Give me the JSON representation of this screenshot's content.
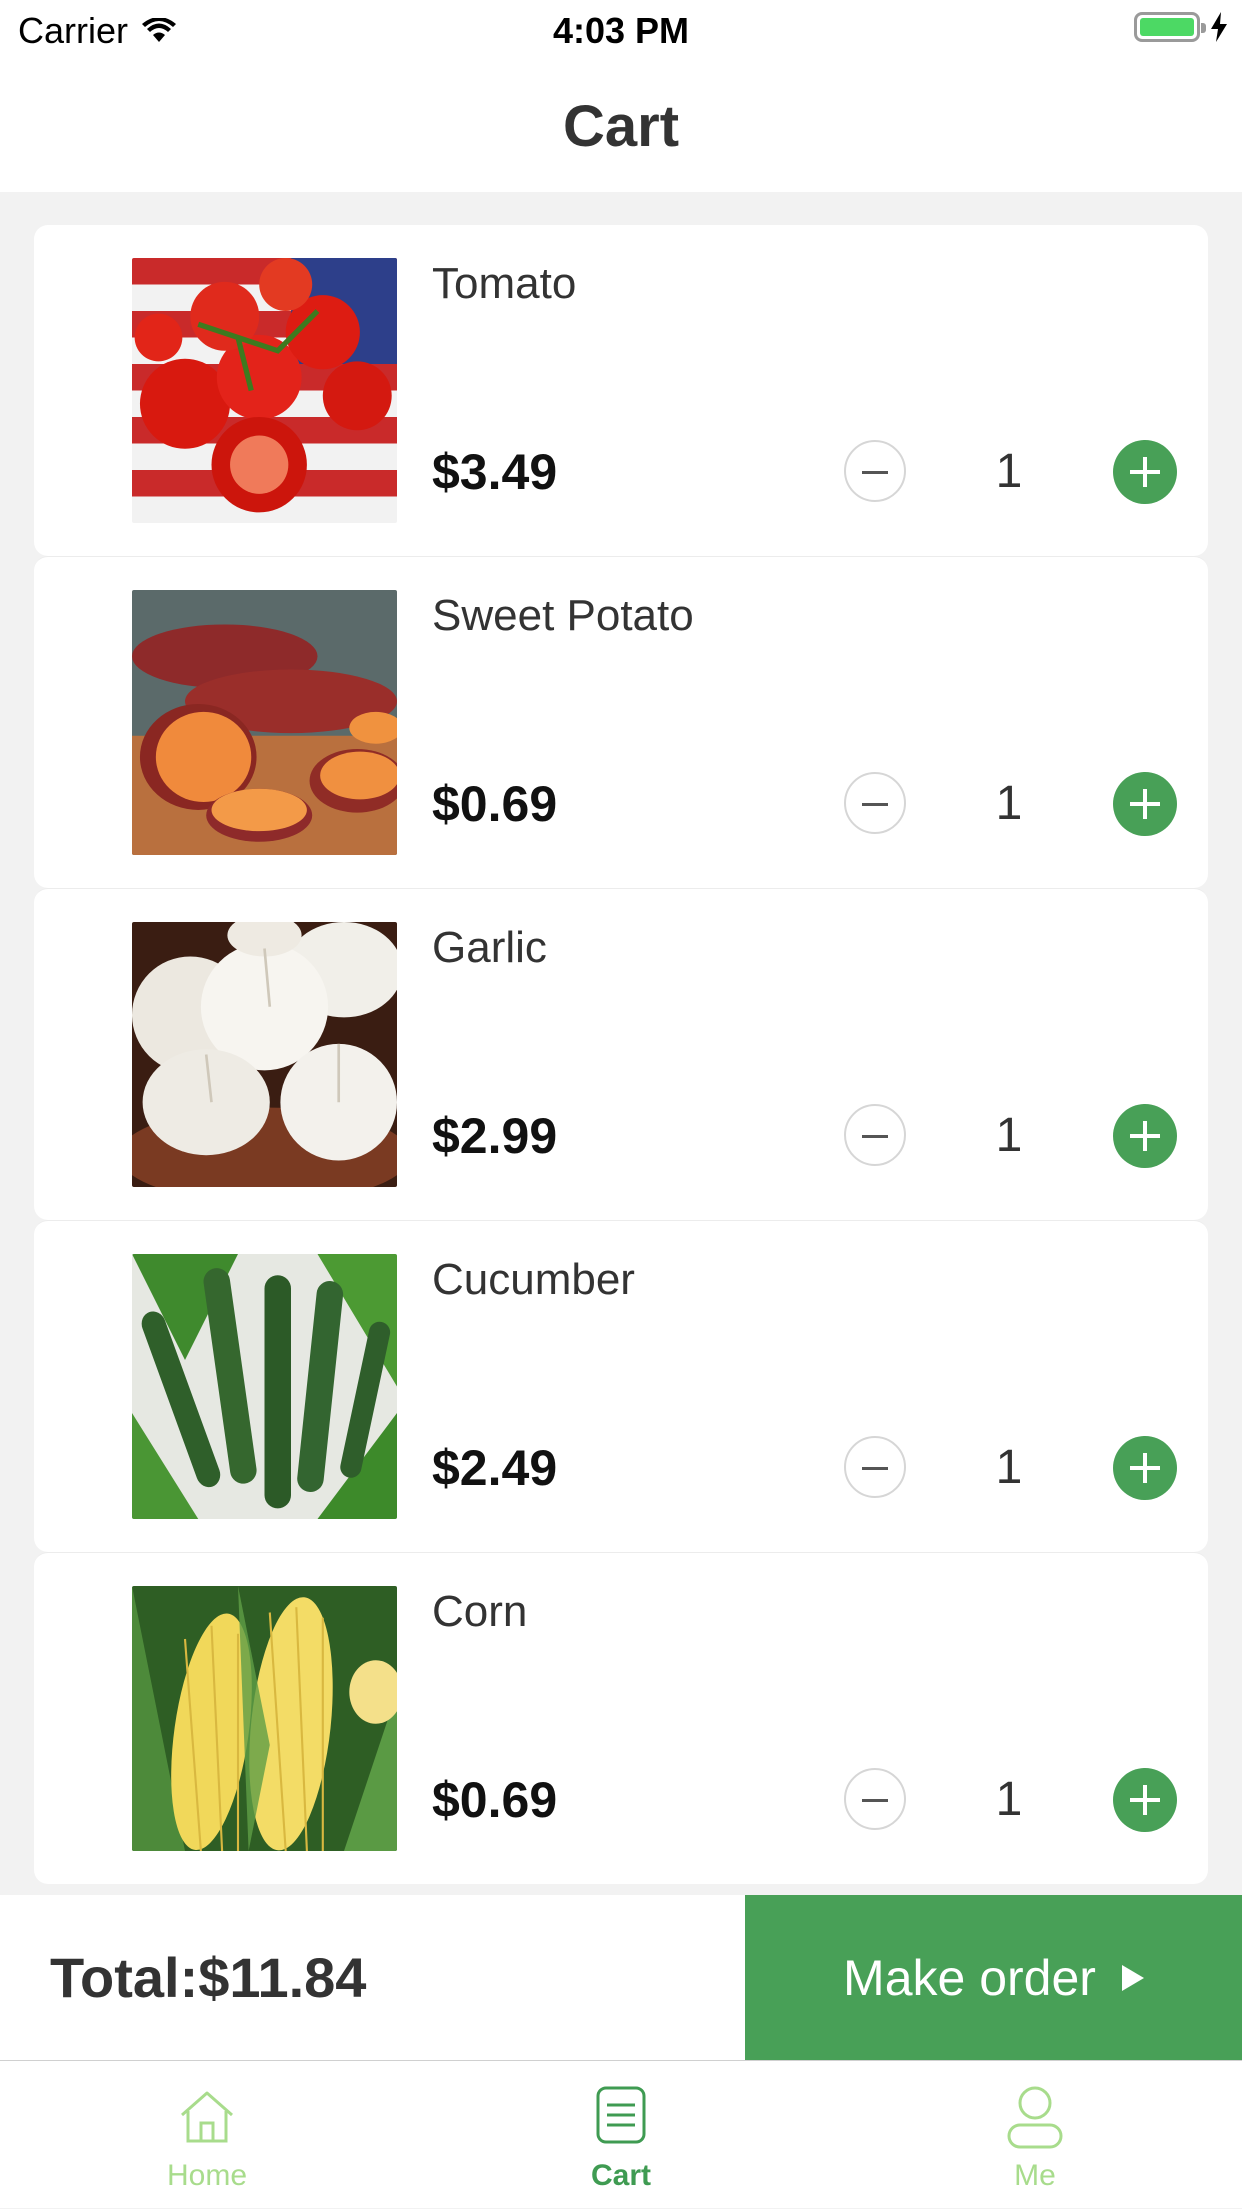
{
  "status_bar": {
    "carrier": "Carrier",
    "time": "4:03 PM"
  },
  "header": {
    "title": "Cart"
  },
  "cart": {
    "items": [
      {
        "name": "Tomato",
        "price": "$3.49",
        "qty": "1",
        "image": "tomato"
      },
      {
        "name": "Sweet Potato",
        "price": "$0.69",
        "qty": "1",
        "image": "sweet-potato"
      },
      {
        "name": "Garlic",
        "price": "$2.99",
        "qty": "1",
        "image": "garlic"
      },
      {
        "name": "Cucumber",
        "price": "$2.49",
        "qty": "1",
        "image": "cucumber"
      },
      {
        "name": "Corn",
        "price": "$0.69",
        "qty": "1",
        "image": "corn"
      }
    ]
  },
  "footer": {
    "total": "Total:$11.84",
    "order_label": "Make order"
  },
  "tabs": [
    {
      "label": "Home",
      "icon": "home-icon",
      "active": false
    },
    {
      "label": "Cart",
      "icon": "cart-list-icon",
      "active": true
    },
    {
      "label": "Me",
      "icon": "person-icon",
      "active": false
    }
  ],
  "colors": {
    "accent": "#48a057",
    "tab_inactive": "#a8dc8c",
    "tab_active": "#3f9b52"
  }
}
